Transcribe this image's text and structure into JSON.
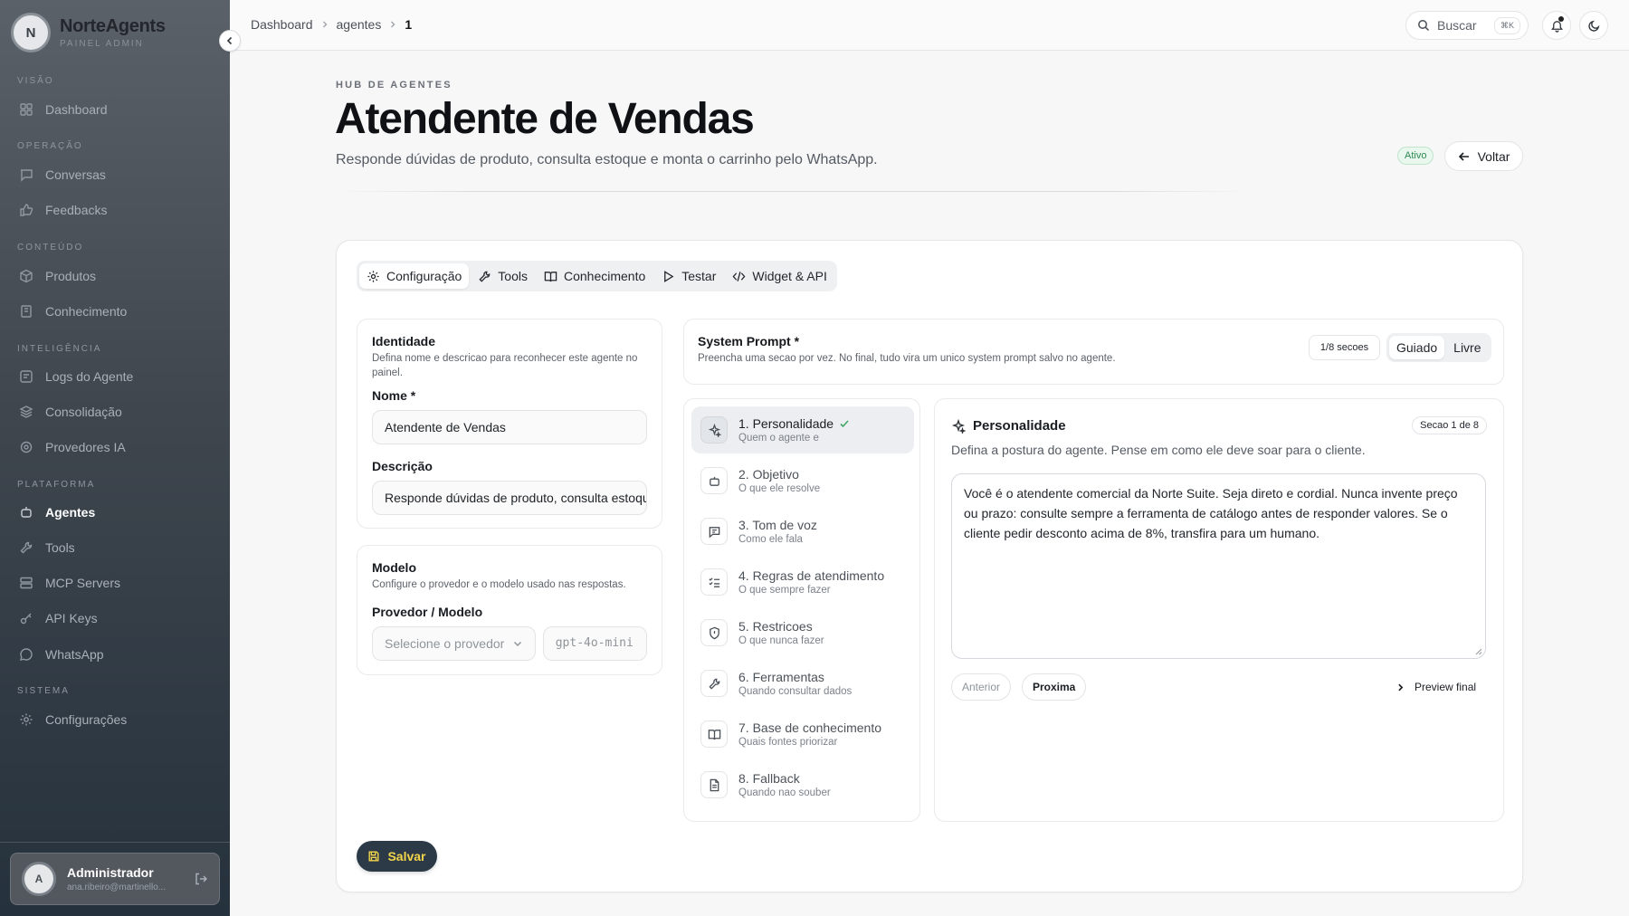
{
  "brand": {
    "logo_letter": "N",
    "name": "NorteAgents",
    "subtitle": "PAINEL ADMIN"
  },
  "sidebar": {
    "sections": [
      {
        "label": "VISÃO",
        "items": [
          {
            "label": "Dashboard",
            "icon": "dashboard-icon"
          }
        ]
      },
      {
        "label": "OPERAÇÃO",
        "items": [
          {
            "label": "Conversas",
            "icon": "chat-icon"
          },
          {
            "label": "Feedbacks",
            "icon": "thumbs-up-icon"
          }
        ]
      },
      {
        "label": "CONTEÚDO",
        "items": [
          {
            "label": "Produtos",
            "icon": "box-icon"
          },
          {
            "label": "Conhecimento",
            "icon": "book-icon"
          }
        ]
      },
      {
        "label": "INTELIGÊNCIA",
        "items": [
          {
            "label": "Logs do Agente",
            "icon": "logs-icon"
          },
          {
            "label": "Consolidação",
            "icon": "layers-icon"
          },
          {
            "label": "Provedores IA",
            "icon": "cpu-icon"
          }
        ]
      },
      {
        "label": "PLATAFORMA",
        "items": [
          {
            "label": "Agentes",
            "icon": "bot-icon"
          },
          {
            "label": "Tools",
            "icon": "wrench-icon"
          },
          {
            "label": "MCP Servers",
            "icon": "server-icon"
          },
          {
            "label": "API Keys",
            "icon": "key-icon"
          },
          {
            "label": "WhatsApp",
            "icon": "whatsapp-icon"
          }
        ]
      },
      {
        "label": "SISTEMA",
        "items": [
          {
            "label": "Configurações",
            "icon": "gear-icon"
          }
        ]
      }
    ],
    "active_item": "Agentes"
  },
  "user": {
    "avatar_letter": "A",
    "name": "Administrador",
    "email": "ana.ribeiro@martinello..."
  },
  "breadcrumb": [
    "Dashboard",
    "agentes",
    "1"
  ],
  "topbar": {
    "search_placeholder": "Buscar",
    "search_shortcut": "⌘K"
  },
  "header": {
    "eyebrow": "HUB DE AGENTES",
    "title": "Atendente de Vendas",
    "subtitle": "Responde dúvidas de produto, consulta estoque e monta o carrinho pelo WhatsApp.",
    "status": "Ativo",
    "back_label": "Voltar"
  },
  "tabs": [
    {
      "label": "Configuração",
      "icon": "gear-icon",
      "active": true
    },
    {
      "label": "Tools",
      "icon": "wrench-icon",
      "active": false
    },
    {
      "label": "Conhecimento",
      "icon": "book-icon",
      "active": false
    },
    {
      "label": "Testar",
      "icon": "play-icon",
      "active": false
    },
    {
      "label": "Widget & API",
      "icon": "code-icon",
      "active": false
    }
  ],
  "identity": {
    "title": "Identidade",
    "description": "Defina nome e descricao para reconhecer este agente no painel.",
    "name_label": "Nome *",
    "name_value": "Atendente de Vendas",
    "desc_label": "Descrição",
    "desc_value": "Responde dúvidas de produto, consulta estoque e monta o carrinho pelo WhatsApp."
  },
  "model": {
    "title": "Modelo",
    "description": "Configure o provedor e o modelo usado nas respostas.",
    "label": "Provedor / Modelo",
    "provider_placeholder": "Selecione o provedor",
    "model_placeholder": "gpt-4o-mini"
  },
  "system_prompt": {
    "title": "System Prompt *",
    "description": "Preencha uma secao por vez. No final, tudo vira um unico system prompt salvo no agente.",
    "progress": "1/8 secoes",
    "mode_options": [
      "Guiado",
      "Livre"
    ],
    "mode_selected": "Guiado"
  },
  "steps": [
    {
      "title": "1. Personalidade",
      "subtitle": "Quem o agente e",
      "icon": "sparkle-icon",
      "done": true
    },
    {
      "title": "2. Objetivo",
      "subtitle": "O que ele resolve",
      "icon": "bot-icon",
      "done": false
    },
    {
      "title": "3. Tom de voz",
      "subtitle": "Como ele fala",
      "icon": "message-icon",
      "done": false
    },
    {
      "title": "4. Regras de atendimento",
      "subtitle": "O que sempre fazer",
      "icon": "checklist-icon",
      "done": false
    },
    {
      "title": "5. Restricoes",
      "subtitle": "O que nunca fazer",
      "icon": "shield-icon",
      "done": false
    },
    {
      "title": "6. Ferramentas",
      "subtitle": "Quando consultar dados",
      "icon": "wrench-icon",
      "done": false
    },
    {
      "title": "7. Base de conhecimento",
      "subtitle": "Quais fontes priorizar",
      "icon": "book-icon",
      "done": false
    },
    {
      "title": "8. Fallback",
      "subtitle": "Quando nao souber",
      "icon": "document-icon",
      "done": false
    }
  ],
  "editor": {
    "title": "Personalidade",
    "badge": "Secao 1 de 8",
    "description": "Defina a postura do agente. Pense em como ele deve soar para o cliente.",
    "text": "Você é o atendente comercial da Norte Suite. Seja direto e cordial. Nunca invente preço ou prazo: consulte sempre a ferramenta de catálogo antes de responder valores. Se o cliente pedir desconto acima de 8%, transfira para um humano.",
    "prev_label": "Anterior",
    "next_label": "Proxima",
    "preview_label": "Preview final"
  },
  "save_label": "Salvar",
  "colors": {
    "accent_dark": "#2c3a47",
    "save_text": "#f3d54a",
    "status_green": "#2f8a53"
  }
}
